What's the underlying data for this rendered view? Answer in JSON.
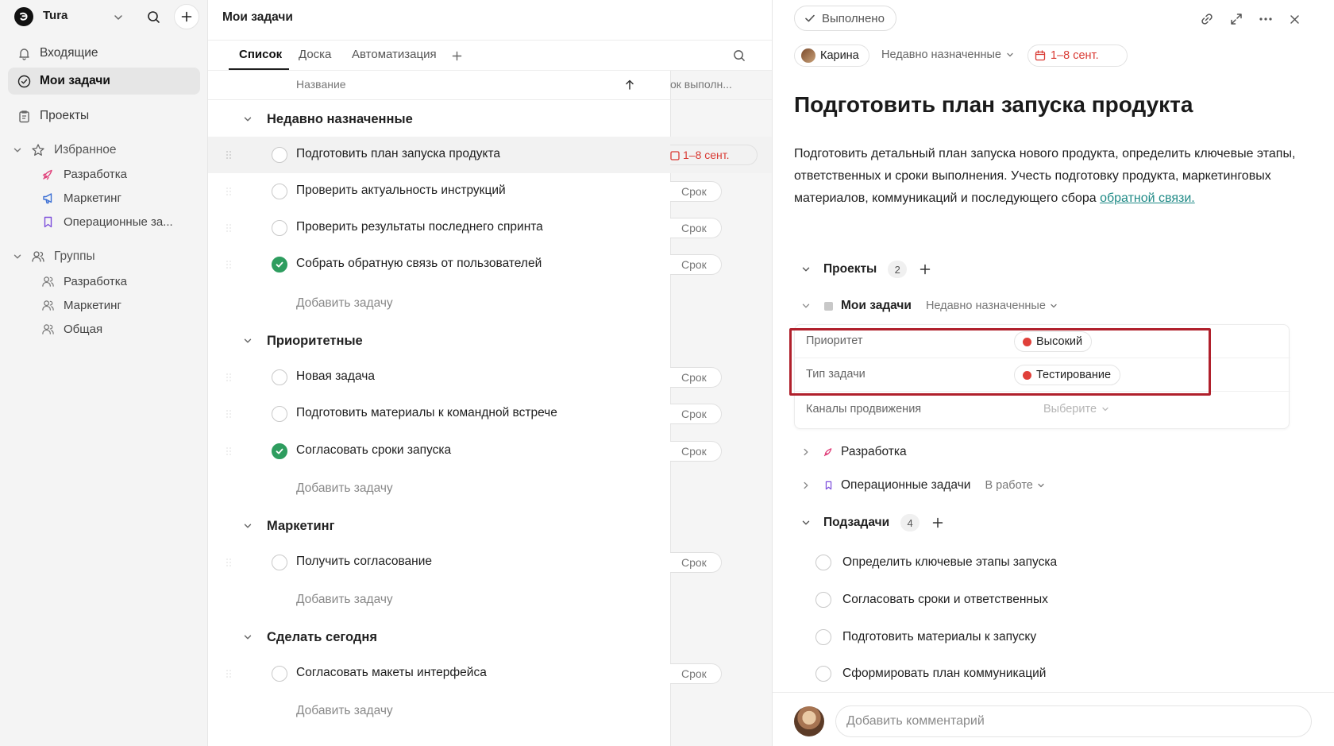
{
  "sidebar": {
    "workspace_name": "Tura",
    "nav": {
      "inbox": "Входящие",
      "my_tasks": "Мои задачи",
      "projects": "Проекты"
    },
    "favorites": {
      "label": "Избранное",
      "items": [
        "Разработка",
        "Маркетинг",
        "Операционные за..."
      ]
    },
    "groups": {
      "label": "Группы",
      "items": [
        "Разработка",
        "Маркетинг",
        "Общая"
      ]
    }
  },
  "main": {
    "title": "Мои задачи",
    "tabs": [
      "Список",
      "Доска",
      "Автоматизация"
    ],
    "columns": {
      "name": "Название",
      "due": "ок выполн..."
    },
    "groups": [
      {
        "title": "Недавно назначенные",
        "tasks": [
          {
            "name": "Подготовить план запуска продукта",
            "due": "1–8 сент.",
            "done": false
          },
          {
            "name": "Проверить актуальность инструкций",
            "due": "Срок",
            "done": false
          },
          {
            "name": "Проверить результаты последнего спринта",
            "due": "Срок",
            "done": false
          },
          {
            "name": "Собрать обратную связь от пользователей",
            "due": "Срок",
            "done": true
          }
        ]
      },
      {
        "title": "Приоритетные",
        "tasks": [
          {
            "name": "Новая задача",
            "due": "Срок",
            "done": false
          },
          {
            "name": "Подготовить материалы к командной встрече",
            "due": "Срок",
            "done": false
          },
          {
            "name": "Согласовать сроки запуска",
            "due": "Срок",
            "done": true
          }
        ]
      },
      {
        "title": "Маркетинг",
        "tasks": [
          {
            "name": "Получить согласование",
            "due": "Срок",
            "done": false
          }
        ]
      },
      {
        "title": "Сделать сегодня",
        "tasks": [
          {
            "name": "Согласовать макеты интерфейса",
            "due": "Срок",
            "done": false
          }
        ]
      }
    ],
    "add_task_label": "Добавить задачу"
  },
  "detail": {
    "done_label": "Выполнено",
    "assignee": "Карина",
    "section_select": "Недавно назначенные",
    "due_range": "1–8 сент.",
    "title": "Подготовить план запуска продукта",
    "description": "Подготовить детальный план запуска нового продукта, определить ключевые этапы, ответственных и сроки выполнения. Учесть подготовку продукта, маркетинговых материалов, коммуникаций и последующего сбора ",
    "description_link": "обратной связи.",
    "projects": {
      "label": "Проекты",
      "count": "2",
      "items": [
        {
          "name": "Мои задачи",
          "status": "Недавно назначенные"
        },
        {
          "name": "Разработка",
          "status": ""
        },
        {
          "name": "Операционные задачи",
          "status": "В работе"
        }
      ]
    },
    "fields": [
      {
        "label": "Приоритет",
        "value": "Высокий"
      },
      {
        "label": "Тип задачи",
        "value": "Тестирование"
      },
      {
        "label": "Каналы продвижения",
        "placeholder": "Выберите"
      }
    ],
    "subtasks": {
      "label": "Подзадачи",
      "count": "4",
      "items": [
        "Определить ключевые этапы запуска",
        "Согласовать сроки и ответственных",
        "Подготовить материалы к запуску",
        "Сформировать план коммуникаций"
      ]
    },
    "comment_placeholder": "Добавить комментарий"
  },
  "colors": {
    "accent_red": "#d93a33",
    "done_green": "#2e9d5f",
    "link_teal": "#1f8a86",
    "highlight_border": "#b0202c"
  }
}
